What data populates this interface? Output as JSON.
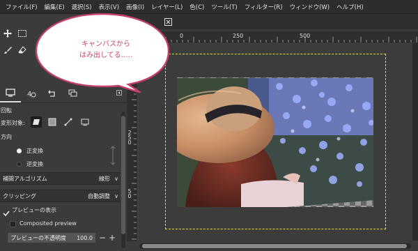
{
  "menu": [
    "ファイル(F)",
    "編集(E)",
    "選択(S)",
    "表示(V)",
    "画像(I)",
    "レイヤー(L)",
    "色(C)",
    "ツール(T)",
    "フィルター(R)",
    "ウィンドウ(W)",
    "ヘルプ(H)"
  ],
  "callout": {
    "line1": "キャンバスから",
    "line2": "はみ出してる…..",
    "color": "#d2436f"
  },
  "ruler": {
    "h_labels": [
      "0",
      "250",
      "500"
    ],
    "v_labels": [
      "2",
      "5",
      "0"
    ],
    "v_labels2": [
      "5",
      "0"
    ]
  },
  "tool_options": {
    "title": "回転",
    "transform_target_label": "変形対象:",
    "direction_label": "方向",
    "direction_options": [
      "正変換",
      "逆変換"
    ],
    "interpolation_label": "補間アルゴリズム",
    "interpolation_value": "線形",
    "clipping_label": "クリッピング",
    "clipping_value": "自動調整",
    "show_preview_label": "プレビューの表示",
    "composited_preview_label": "Composited preview",
    "preview_opacity_label": "プレビューの不透明度",
    "preview_opacity_value": "100.0"
  },
  "colors": {
    "selection_boundary": "#e8e020",
    "accent": "#d2436f"
  }
}
